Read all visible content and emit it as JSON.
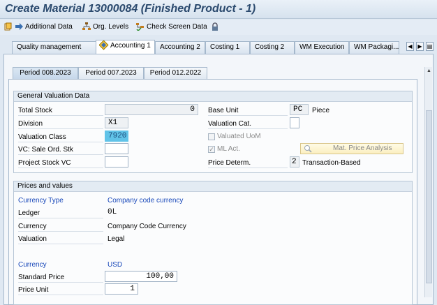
{
  "window": {
    "title": "Create Material 13000084 (Finished Product - 1)"
  },
  "toolbar": {
    "additional_data": "Additional Data",
    "org_levels": "Org. Levels",
    "check_screen_data": "Check Screen Data"
  },
  "tabs": {
    "quality_management": "Quality management",
    "accounting1": "Accounting 1",
    "accounting2": "Accounting 2",
    "costing1": "Costing 1",
    "costing2": "Costing 2",
    "wm_execution": "WM Execution",
    "wm_packaging": "WM Packagi..."
  },
  "period_tabs": {
    "p1": "Period 008.2023",
    "p2": "Period 007.2023",
    "p3": "Period 012.2022"
  },
  "general": {
    "title": "General Valuation Data",
    "total_stock_label": "Total Stock",
    "total_stock_value": "0",
    "division_label": "Division",
    "division_value": "X1",
    "valuation_class_label": "Valuation Class",
    "valuation_class_value": "7920",
    "vc_sale_label": "VC: Sale Ord. Stk",
    "project_stock_label": "Project Stock VC",
    "base_unit_label": "Base Unit",
    "base_unit_value": "PC",
    "base_unit_text": "Piece",
    "valuation_cat_label": "Valuation Cat.",
    "valuated_uom_label": "Valuated UoM",
    "ml_act_label": "ML Act.",
    "price_determ_label": "Price Determ.",
    "price_determ_value": "2",
    "price_determ_text": "Transaction-Based",
    "mat_price_btn": "Mat. Price Analysis"
  },
  "prices": {
    "title": "Prices and values",
    "currency_type_label": "Currency Type",
    "currency_type_value": "Company code currency",
    "ledger_label": "Ledger",
    "ledger_value": "0L",
    "currency_label": "Currency",
    "currency_value": "Company Code Currency",
    "valuation_label": "Valuation",
    "valuation_value": "Legal",
    "currency2_label": "Currency",
    "currency2_value": "USD",
    "standard_price_label": "Standard Price",
    "standard_price_value": "100,00",
    "price_unit_label": "Price Unit",
    "price_unit_value": "1"
  },
  "colors": {
    "accent": "#2b4a6e",
    "link_blue": "#1747b9",
    "highlight": "#61c3e8"
  }
}
